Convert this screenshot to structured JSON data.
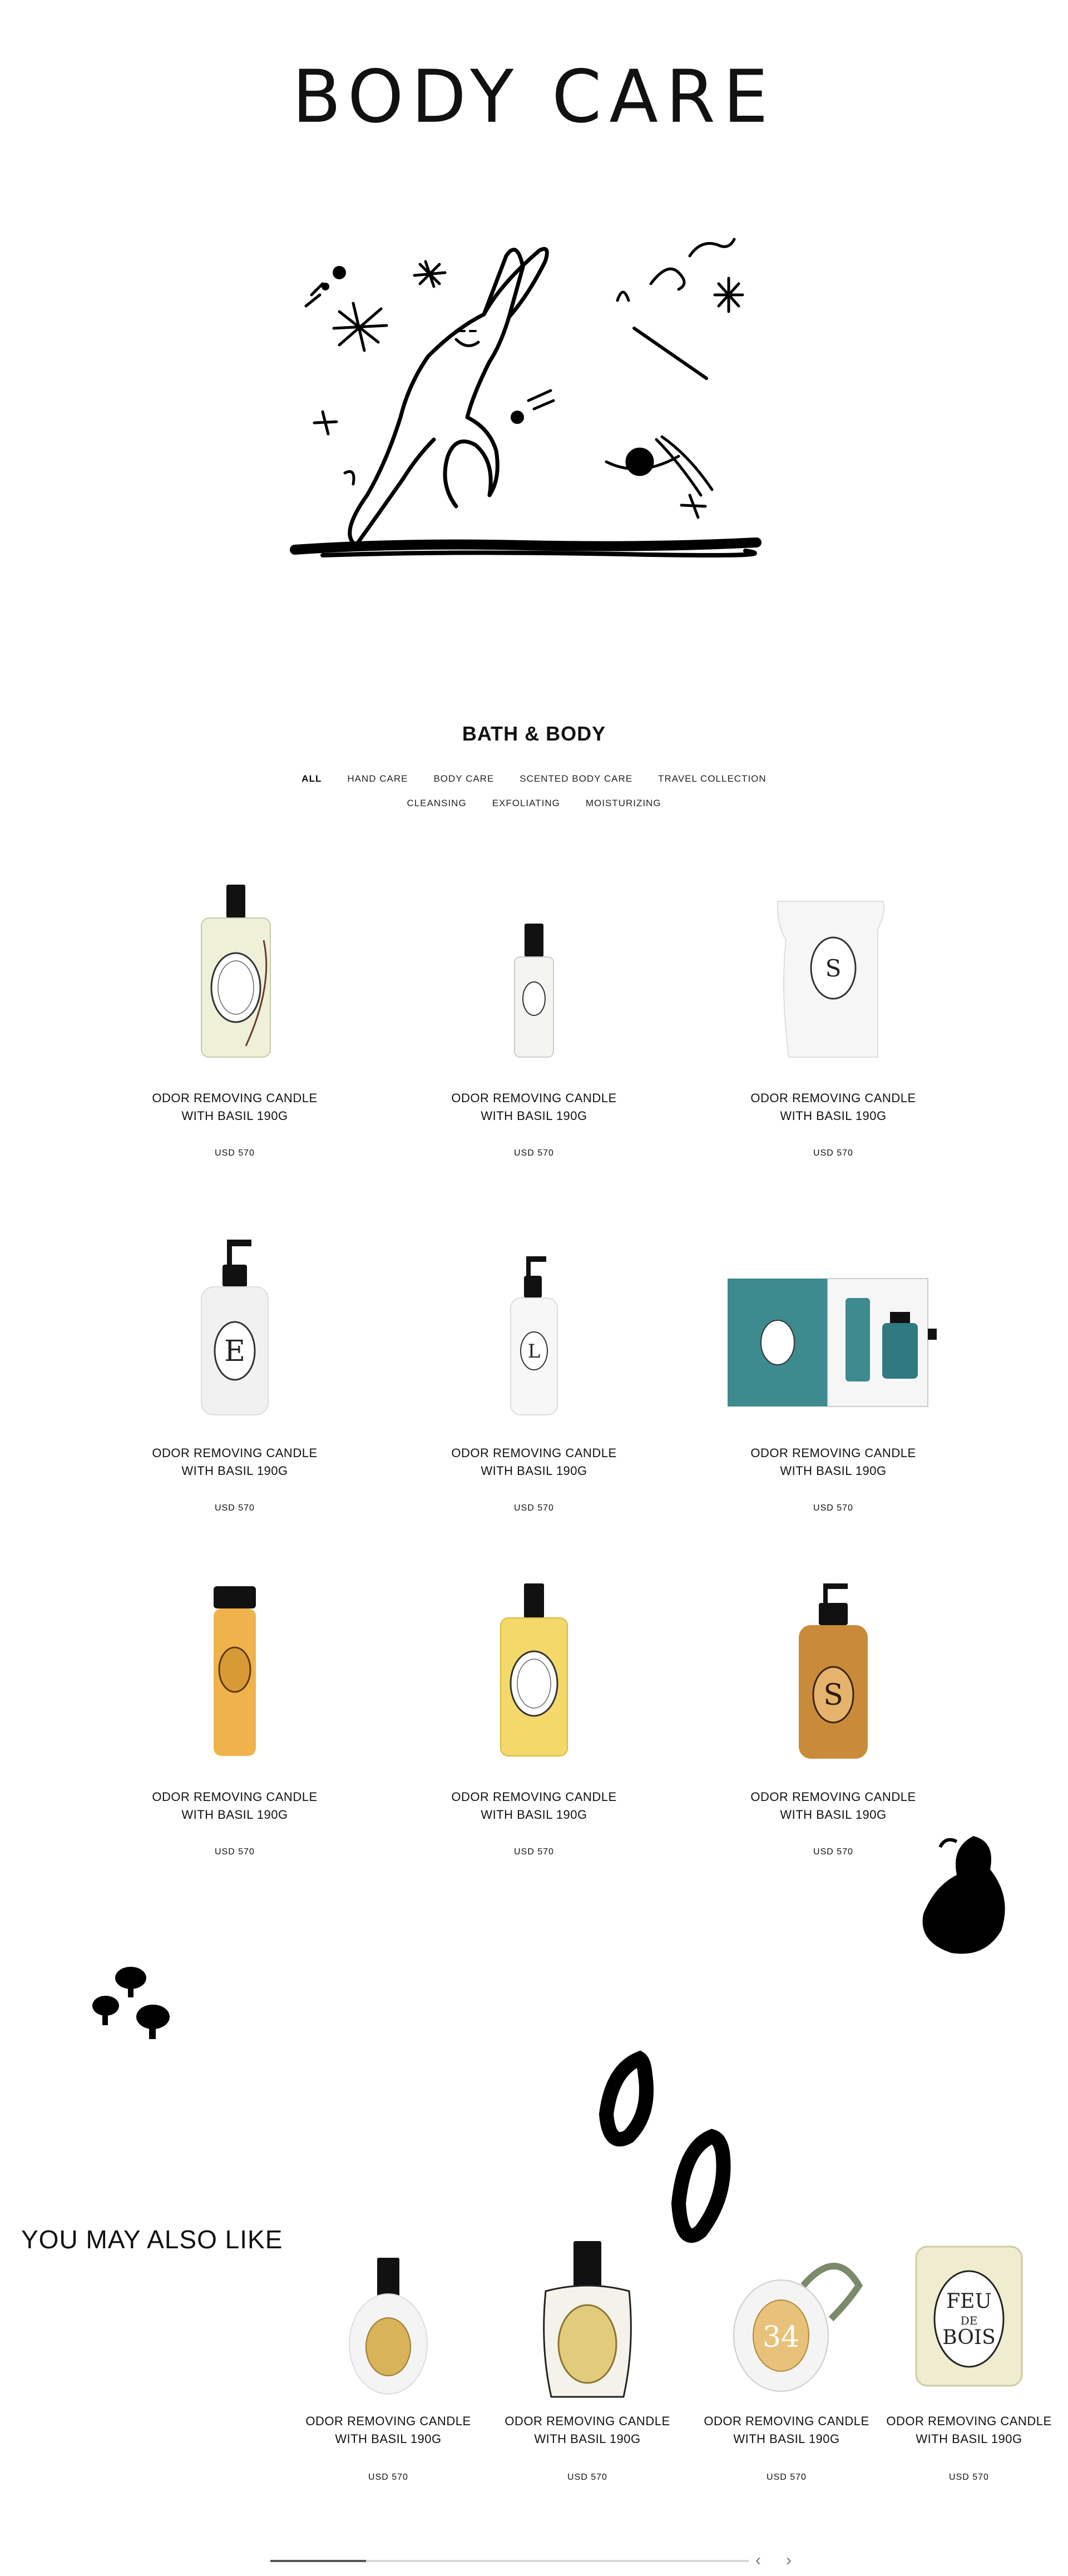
{
  "hero": {
    "title": "BODY CARE"
  },
  "section": {
    "title": "BATH & BODY"
  },
  "filters": {
    "row1": [
      "ALL",
      "HAND CARE",
      "BODY CARE",
      "SCENTED BODY CARE",
      "TRAVEL COLLECTION"
    ],
    "row2": [
      "CLEANSING",
      "EXFOLIATING",
      "MOISTURIZING"
    ],
    "active": "ALL"
  },
  "products": [
    {
      "name_line1": "ODOR REMOVING CANDLE",
      "name_line2": "WITH BASIL 190G",
      "price": "USD 570",
      "image": "clear-glass-spray-bottle"
    },
    {
      "name_line1": "ODOR REMOVING CANDLE",
      "name_line2": "WITH BASIL 190G",
      "price": "USD 570",
      "image": "small-clear-bottle"
    },
    {
      "name_line1": "ODOR REMOVING CANDLE",
      "name_line2": "WITH BASIL 190G",
      "price": "USD 570",
      "image": "white-refill-pouch"
    },
    {
      "name_line1": "ODOR REMOVING CANDLE",
      "name_line2": "WITH BASIL 190G",
      "price": "USD 570",
      "image": "pump-bottle-e"
    },
    {
      "name_line1": "ODOR REMOVING CANDLE",
      "name_line2": "WITH BASIL 190G",
      "price": "USD 570",
      "image": "pump-bottle-l"
    },
    {
      "name_line1": "ODOR REMOVING CANDLE",
      "name_line2": "WITH BASIL 190G",
      "price": "USD 570",
      "image": "teal-gift-box"
    },
    {
      "name_line1": "ODOR REMOVING CANDLE",
      "name_line2": "WITH BASIL 190G",
      "price": "USD 570",
      "image": "amber-shower-tube"
    },
    {
      "name_line1": "ODOR REMOVING CANDLE",
      "name_line2": "WITH BASIL 190G",
      "price": "USD 570",
      "image": "yellow-oil-bottle"
    },
    {
      "name_line1": "ODOR REMOVING CANDLE",
      "name_line2": "WITH BASIL 190G",
      "price": "USD 570",
      "image": "amber-pump-bottle-s"
    }
  ],
  "related": {
    "title": "YOU MAY ALSO LIKE",
    "items": [
      {
        "name_line1": "ODOR REMOVING CANDLE",
        "name_line2": "WITH BASIL 190G",
        "price": "USD 570",
        "image": "white-gold-perfume"
      },
      {
        "name_line1": "ODOR REMOVING CANDLE",
        "name_line2": "WITH BASIL 190G",
        "price": "USD 570",
        "image": "clear-gold-perfume"
      },
      {
        "name_line1": "ODOR REMOVING CANDLE",
        "name_line2": "WITH BASIL 190G",
        "price": "USD 570",
        "image": "car-diffuser-34"
      },
      {
        "name_line1": "ODOR REMOVING CANDLE",
        "name_line2": "WITH BASIL 190G",
        "price": "USD 570",
        "image": "feu-de-bois-candle"
      }
    ],
    "progress": 0.2,
    "prev_icon": "chevron-left-icon",
    "next_icon": "chevron-right-icon"
  },
  "colors": {
    "accent": "#000000",
    "teal_box": "#3d8a8f",
    "amber": "#e9a33a",
    "gold": "#d9b35a"
  }
}
